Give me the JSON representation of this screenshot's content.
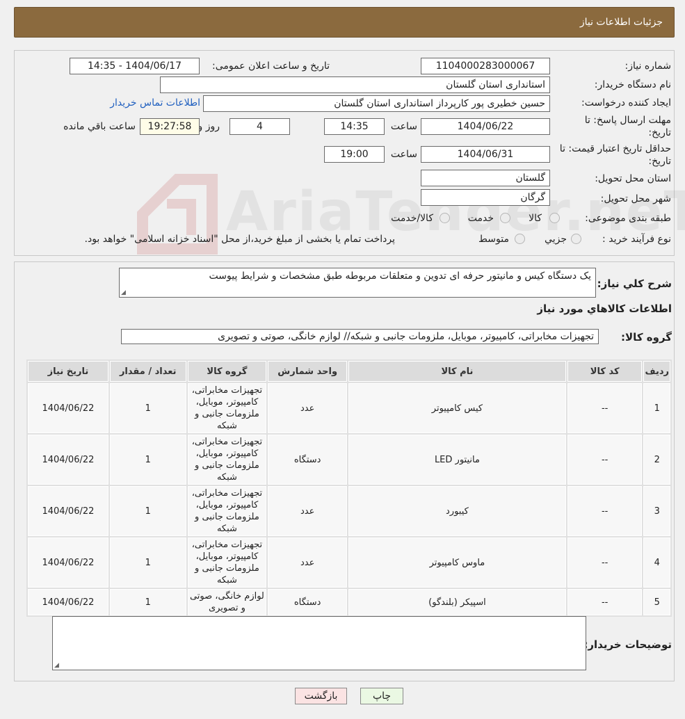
{
  "header": {
    "title": "جزئیات اطلاعات نیاز"
  },
  "form": {
    "need_number_label": "شماره نیاز:",
    "need_number": "1104000283000067",
    "announce_label": "تاریخ و ساعت اعلان عمومی:",
    "announce_value": "1404/06/17 - 14:35",
    "buyer_org_label": "نام دستگاه خریدار:",
    "buyer_org": "استانداری استان گلستان",
    "creator_label": "ایجاد کننده درخواست:",
    "creator": "حسین خطیری پور کارپرداز استانداری استان گلستان",
    "contact_link": "اطلاعات تماس خریدار",
    "deadline_label_1": "مهلت ارسال پاسخ: تا",
    "deadline_label_2": "تاریخ:",
    "deadline_date": "1404/06/22",
    "time_label": "ساعت",
    "deadline_time": "14:35",
    "days_value": "4",
    "days_label": "روز و",
    "remaining_time": "19:27:58",
    "remaining_label": "ساعت باقي مانده",
    "validity_label_1": "حداقل تاریخ اعتبار قیمت: تا",
    "validity_label_2": "تاریخ:",
    "validity_date": "1404/06/31",
    "validity_time": "19:00",
    "province_label": "استان محل تحویل:",
    "province": "گلستان",
    "city_label": "شهر محل تحویل:",
    "city": "گرگان",
    "category_label": "طبقه بندی موضوعی:",
    "category_options": [
      "کالا",
      "خدمت",
      "کالا/خدمت"
    ],
    "process_label": "نوع فرآیند خرید :",
    "process_options": [
      "جزیي",
      "متوسط"
    ],
    "process_note": "پرداخت تمام یا بخشی از مبلغ خرید،از محل \"اسناد خزانه اسلامی\" خواهد بود."
  },
  "details": {
    "description_label": "شرح کلي نیاز:",
    "description": "یک دستگاه کیس و مانیتور حرفه ای تدوین و متعلقات مربوطه طبق مشخصات و شرایط پیوست",
    "items_title": "اطلاعات کالاهاي مورد نیاز",
    "group_label": "گروه کالا:",
    "group_value": "تجهیزات مخابراتی، کامپیوتر، موبایل، ملزومات جانبی و شبکه// لوازم خانگی، صوتی و تصویری",
    "table": {
      "headers": [
        "ردیف",
        "کد کالا",
        "نام کالا",
        "واحد شمارش",
        "گروه کالا",
        "تعداد / مقدار",
        "تاریخ نیاز"
      ],
      "rows": [
        [
          "1",
          "--",
          "کیس کامپیوتر",
          "عدد",
          "تجهیزات مخابراتی، کامپیوتر، موبایل، ملزومات جانبی و شبکه",
          "1",
          "1404/06/22"
        ],
        [
          "2",
          "--",
          "مانیتور LED",
          "دستگاه",
          "تجهیزات مخابراتی، کامپیوتر، موبایل، ملزومات جانبی و شبکه",
          "1",
          "1404/06/22"
        ],
        [
          "3",
          "--",
          "کیبورد",
          "عدد",
          "تجهیزات مخابراتی، کامپیوتر، موبایل، ملزومات جانبی و شبکه",
          "1",
          "1404/06/22"
        ],
        [
          "4",
          "--",
          "ماوس کامپیوتر",
          "عدد",
          "تجهیزات مخابراتی، کامپیوتر، موبایل، ملزومات جانبی و شبکه",
          "1",
          "1404/06/22"
        ],
        [
          "5",
          "--",
          "اسپیکر (بلندگو)",
          "دستگاه",
          "لوازم خانگی، صوتی و تصویری",
          "1",
          "1404/06/22"
        ]
      ]
    },
    "buyer_notes_label": "توضیحات خریدار:",
    "buyer_notes": ""
  },
  "buttons": {
    "print": "چاپ",
    "back": "بازگشت"
  },
  "watermark": {
    "text": "AriaTender.neT"
  },
  "colors": {
    "header_bg": "#8b6a3e",
    "link": "#1f5fbf",
    "back_button_bg": "#fbe3e3",
    "print_button_bg": "#eaf8e3"
  }
}
